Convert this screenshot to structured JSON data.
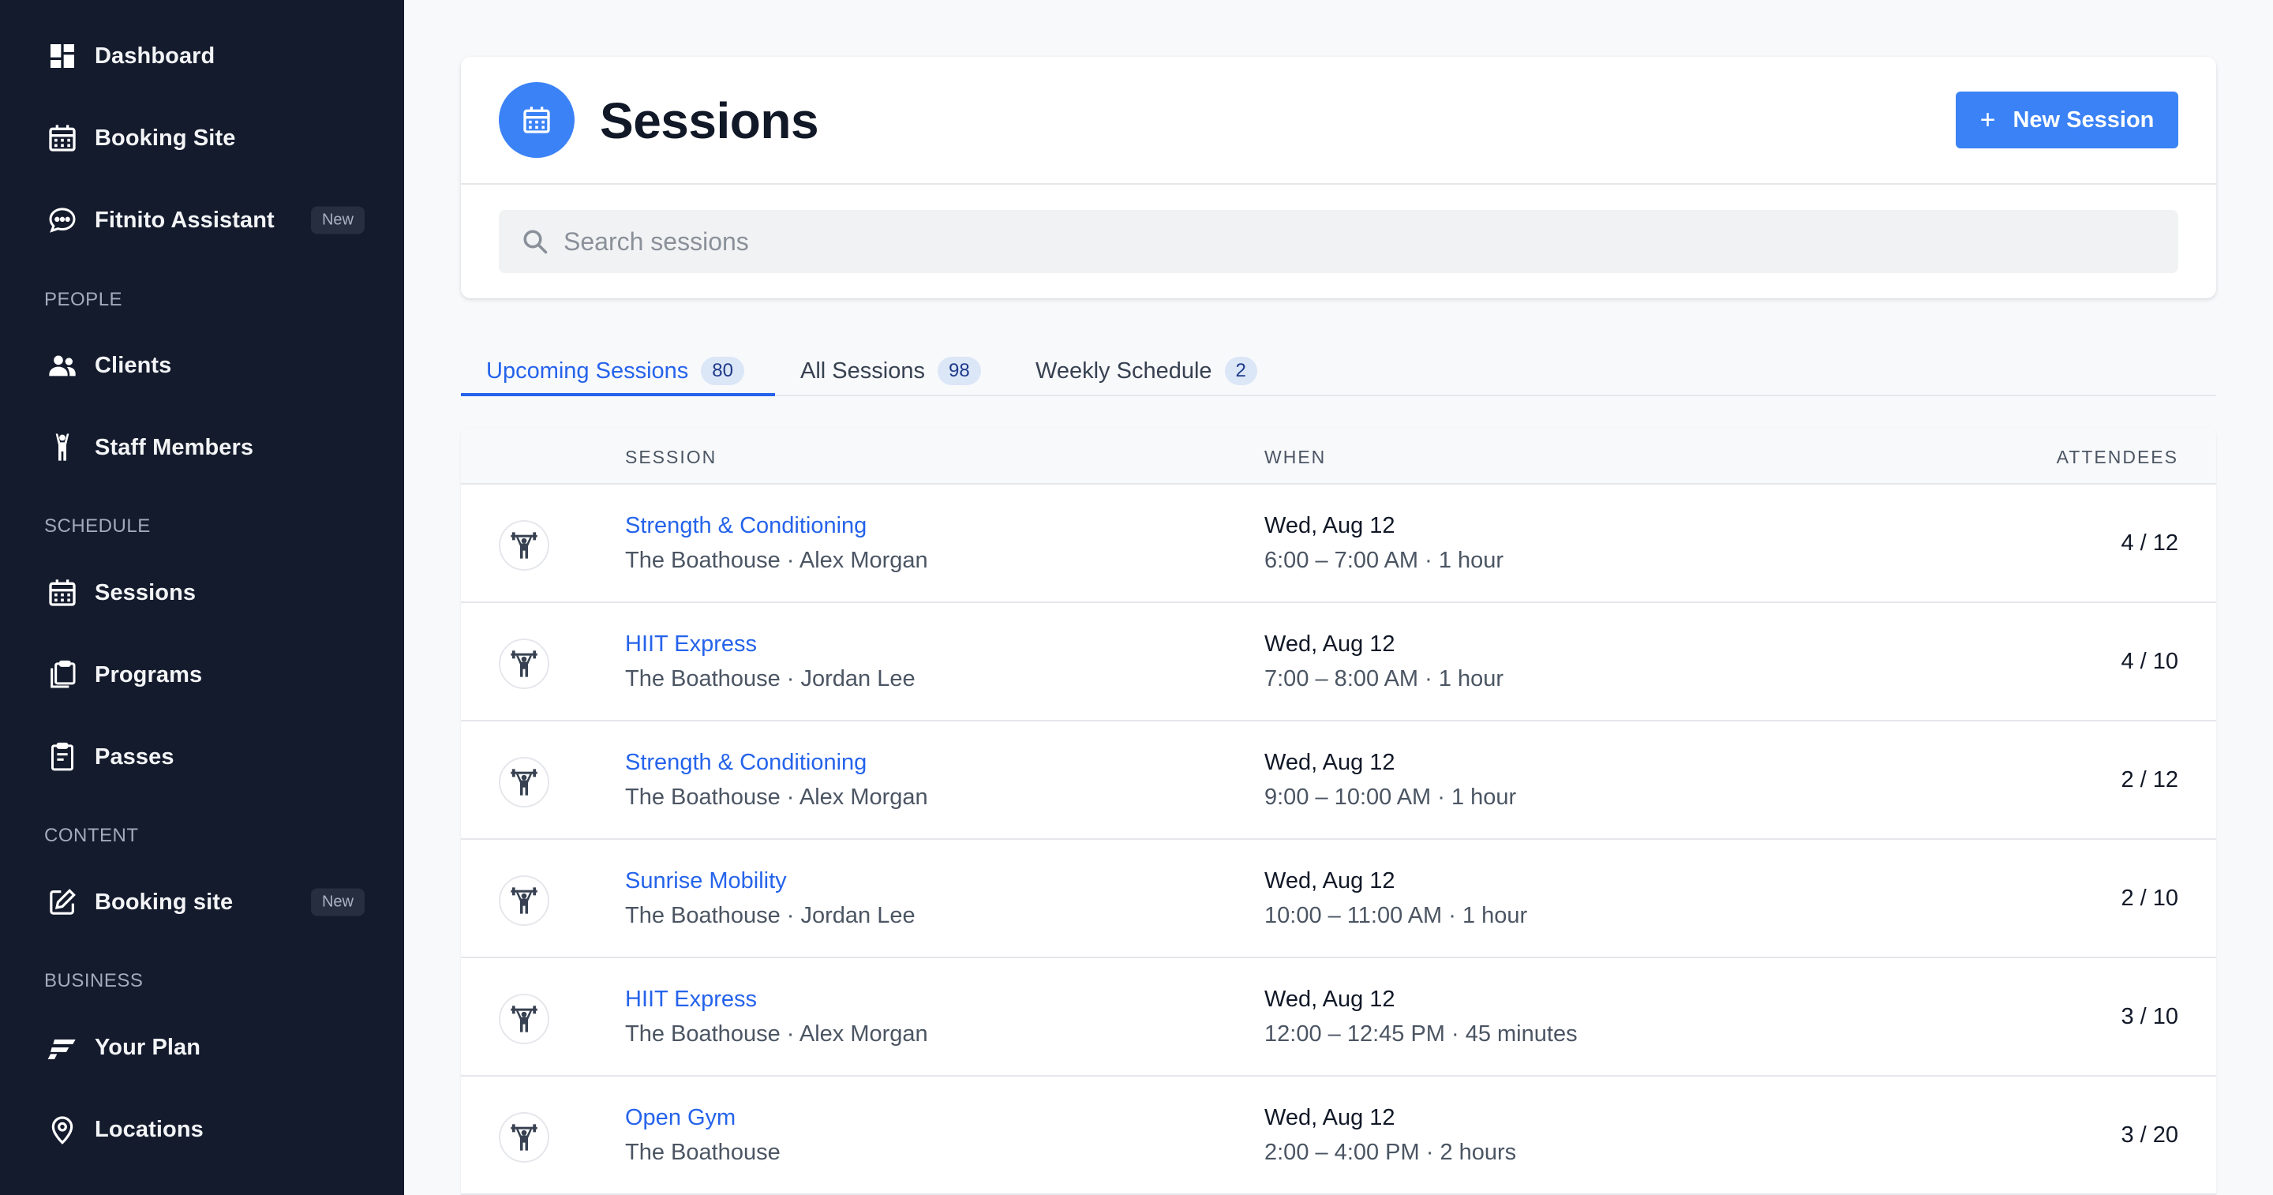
{
  "sidebar": {
    "top_items": [
      {
        "label": "Dashboard",
        "icon": "dashboard-icon"
      },
      {
        "label": "Booking Site",
        "icon": "calendar-icon"
      },
      {
        "label": "Fitnito Assistant",
        "icon": "chat-bubble-icon",
        "badge": "New"
      }
    ],
    "sections": [
      {
        "title": "PEOPLE",
        "items": [
          {
            "label": "Clients",
            "icon": "people-icon"
          },
          {
            "label": "Staff Members",
            "icon": "person-arms-up-icon"
          }
        ]
      },
      {
        "title": "SCHEDULE",
        "items": [
          {
            "label": "Sessions",
            "icon": "calendar-icon"
          },
          {
            "label": "Programs",
            "icon": "clipboard-stack-icon"
          },
          {
            "label": "Passes",
            "icon": "clipboard-icon"
          }
        ]
      },
      {
        "title": "CONTENT",
        "items": [
          {
            "label": "Booking site",
            "icon": "edit-icon",
            "badge": "New"
          }
        ]
      },
      {
        "title": "BUSINESS",
        "items": [
          {
            "label": "Your Plan",
            "icon": "fitnito-logo-icon"
          },
          {
            "label": "Locations",
            "icon": "map-pin-icon"
          }
        ]
      }
    ]
  },
  "header": {
    "title": "Sessions",
    "new_button_label": "New Session",
    "search_placeholder": "Search sessions"
  },
  "tabs": [
    {
      "label": "Upcoming Sessions",
      "count": "80",
      "active": true
    },
    {
      "label": "All Sessions",
      "count": "98",
      "active": false
    },
    {
      "label": "Weekly Schedule",
      "count": "2",
      "active": false
    }
  ],
  "table": {
    "columns": [
      "SESSION",
      "WHEN",
      "ATTENDEES"
    ],
    "rows": [
      {
        "name": "Strength & Conditioning",
        "subtitle": "The Boathouse · Alex Morgan",
        "date": "Wed, Aug 12",
        "time": "6:00 – 7:00 AM · 1 hour",
        "attendees": "4 / 12"
      },
      {
        "name": "HIIT Express",
        "subtitle": "The Boathouse · Jordan Lee",
        "date": "Wed, Aug 12",
        "time": "7:00 – 8:00 AM · 1 hour",
        "attendees": "4 / 10"
      },
      {
        "name": "Strength & Conditioning",
        "subtitle": "The Boathouse · Alex Morgan",
        "date": "Wed, Aug 12",
        "time": "9:00 – 10:00 AM · 1 hour",
        "attendees": "2 / 12"
      },
      {
        "name": "Sunrise Mobility",
        "subtitle": "The Boathouse · Jordan Lee",
        "date": "Wed, Aug 12",
        "time": "10:00 – 11:00 AM · 1 hour",
        "attendees": "2 / 10"
      },
      {
        "name": "HIIT Express",
        "subtitle": "The Boathouse · Alex Morgan",
        "date": "Wed, Aug 12",
        "time": "12:00 – 12:45 PM · 45 minutes",
        "attendees": "3 / 10"
      },
      {
        "name": "Open Gym",
        "subtitle": "The Boathouse",
        "date": "Wed, Aug 12",
        "time": "2:00 – 4:00 PM · 2 hours",
        "attendees": "3 / 20"
      }
    ]
  },
  "colors": {
    "sidebar_bg": "#141b2d",
    "accent": "#3b82f6",
    "link": "#2563eb",
    "page_bg": "#f8f9fb"
  }
}
